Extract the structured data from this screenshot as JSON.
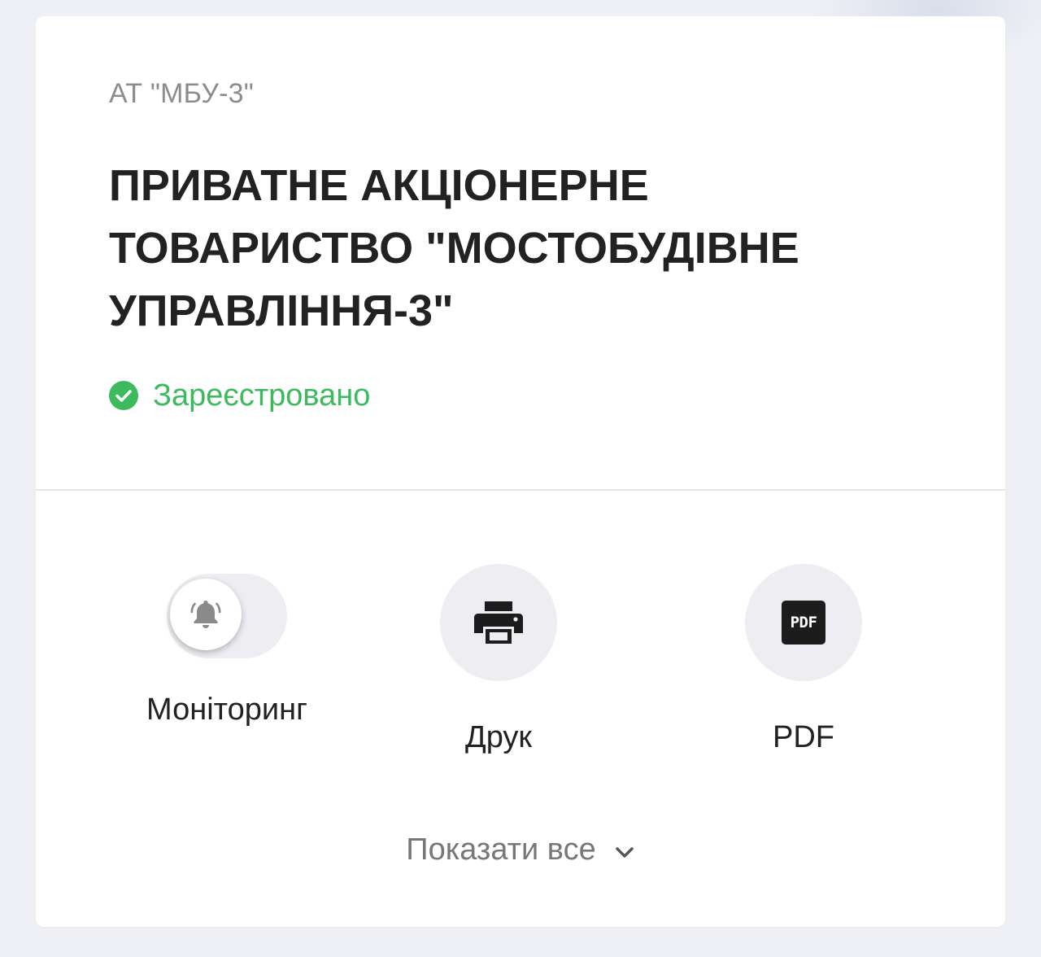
{
  "company": {
    "short_name": "АТ \"МБУ-3\"",
    "full_name": "ПРИВАТНЕ АКЦІОНЕРНЕ ТОВАРИСТВО \"МОСТОБУДІВНЕ УПРАВЛІННЯ-3\"",
    "status": {
      "text": "Зареєстровано",
      "icon": "check-circle-icon",
      "color": "#3dba5d"
    }
  },
  "actions": {
    "monitoring": {
      "label": "Моніторинг",
      "icon": "bell-icon",
      "enabled": false
    },
    "print": {
      "label": "Друк",
      "icon": "printer-icon"
    },
    "pdf": {
      "label": "PDF",
      "icon": "pdf-icon",
      "icon_text": "PDF"
    }
  },
  "show_all": {
    "label": "Показати все",
    "icon": "chevron-down-icon"
  }
}
